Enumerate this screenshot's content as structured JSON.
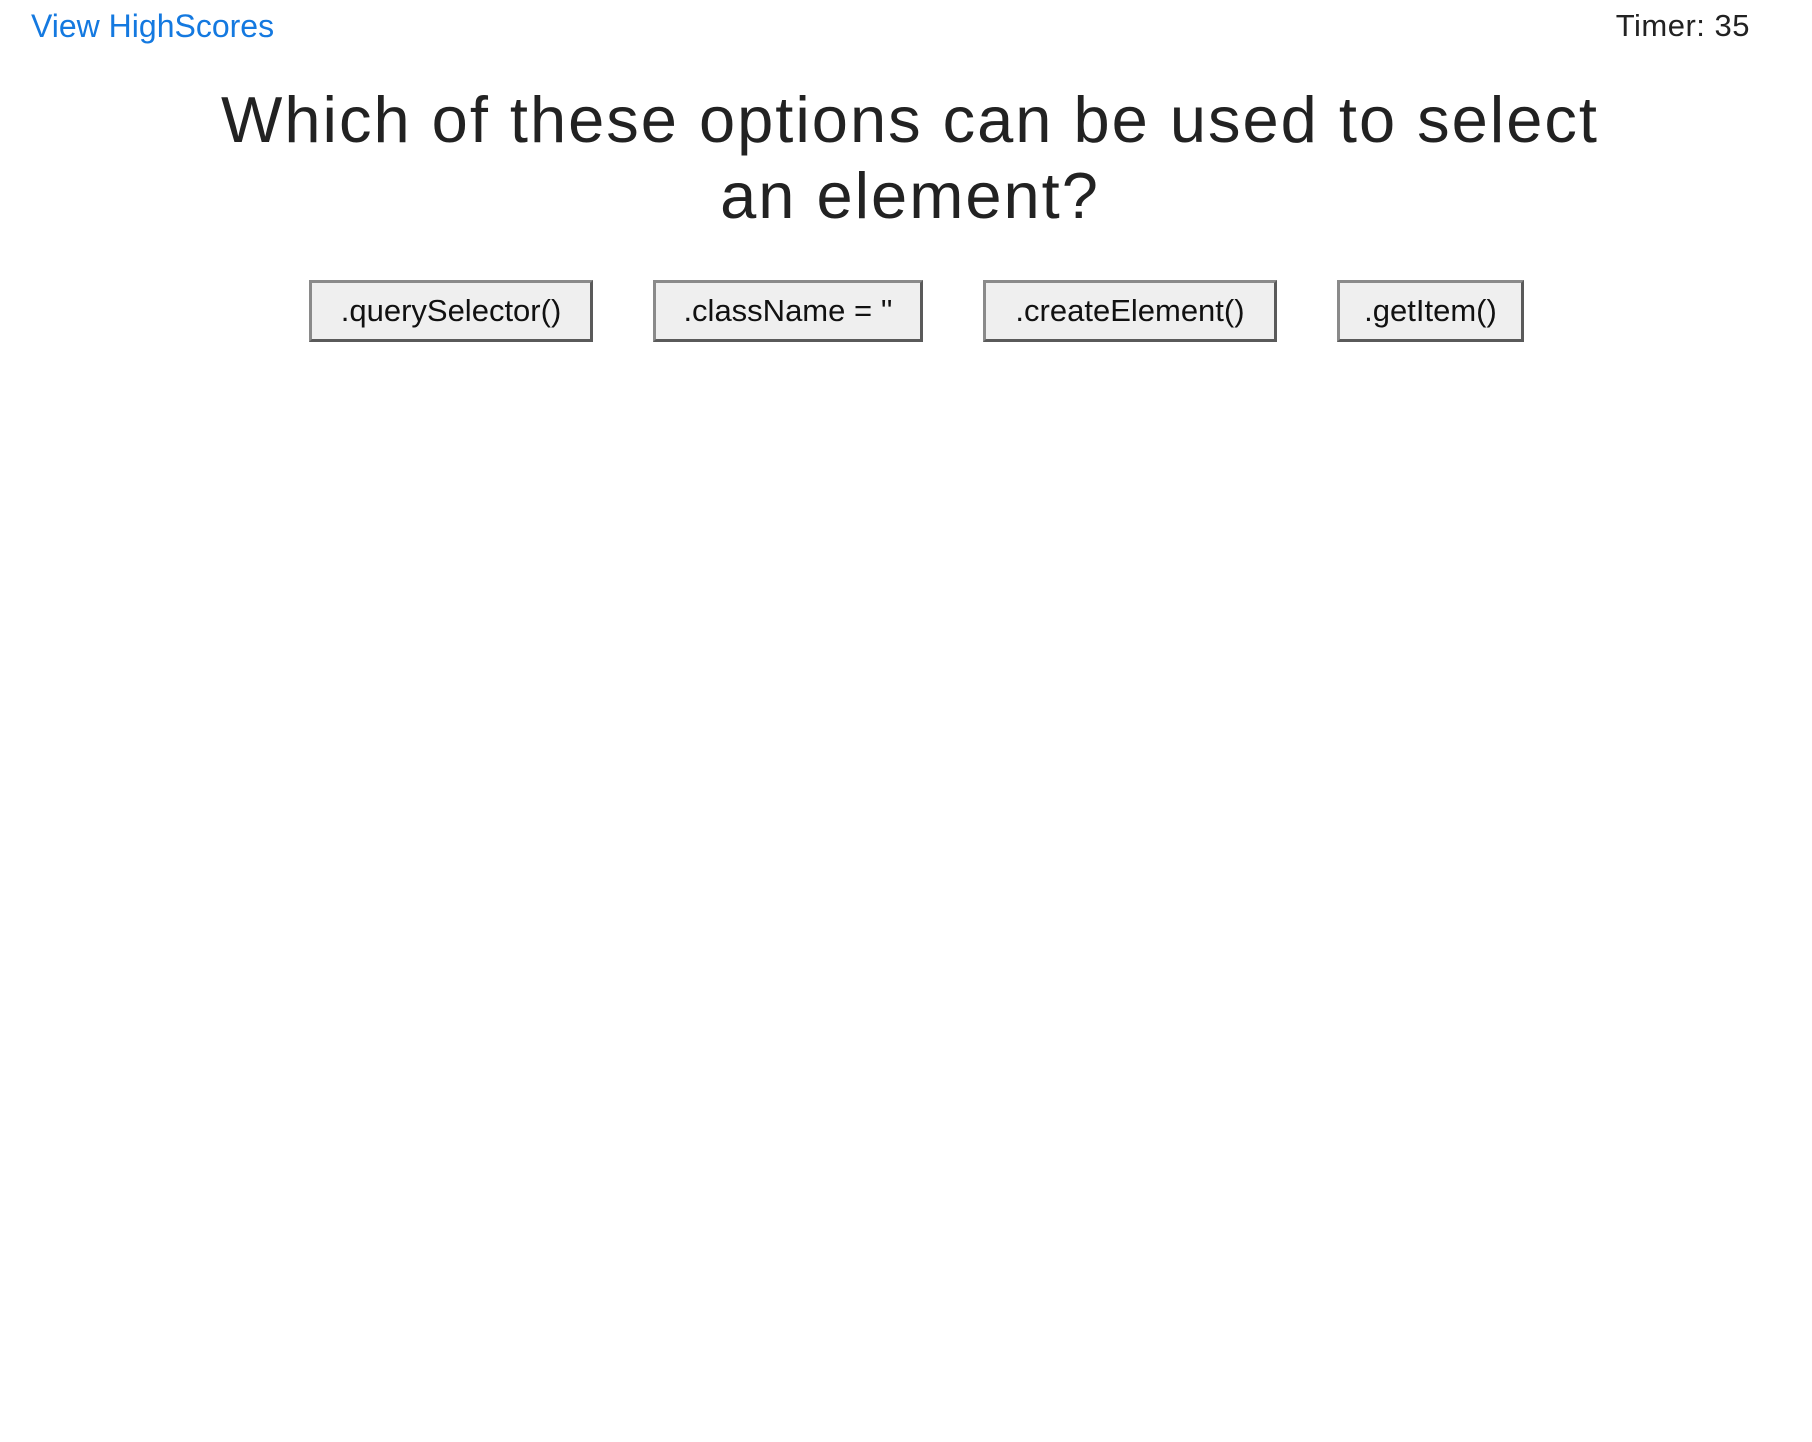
{
  "header": {
    "highscores_link": "View HighScores",
    "timer_text": "Timer: 35"
  },
  "quiz": {
    "question": "Which of these options can be used to select an element?",
    "options": [
      ".querySelector()",
      ".className = ''",
      ".createElement()",
      ".getItem()"
    ]
  },
  "colors": {
    "link": "#1479e0",
    "text": "#222222",
    "button_bg": "#efefef",
    "button_border": "#5a5a5a"
  }
}
